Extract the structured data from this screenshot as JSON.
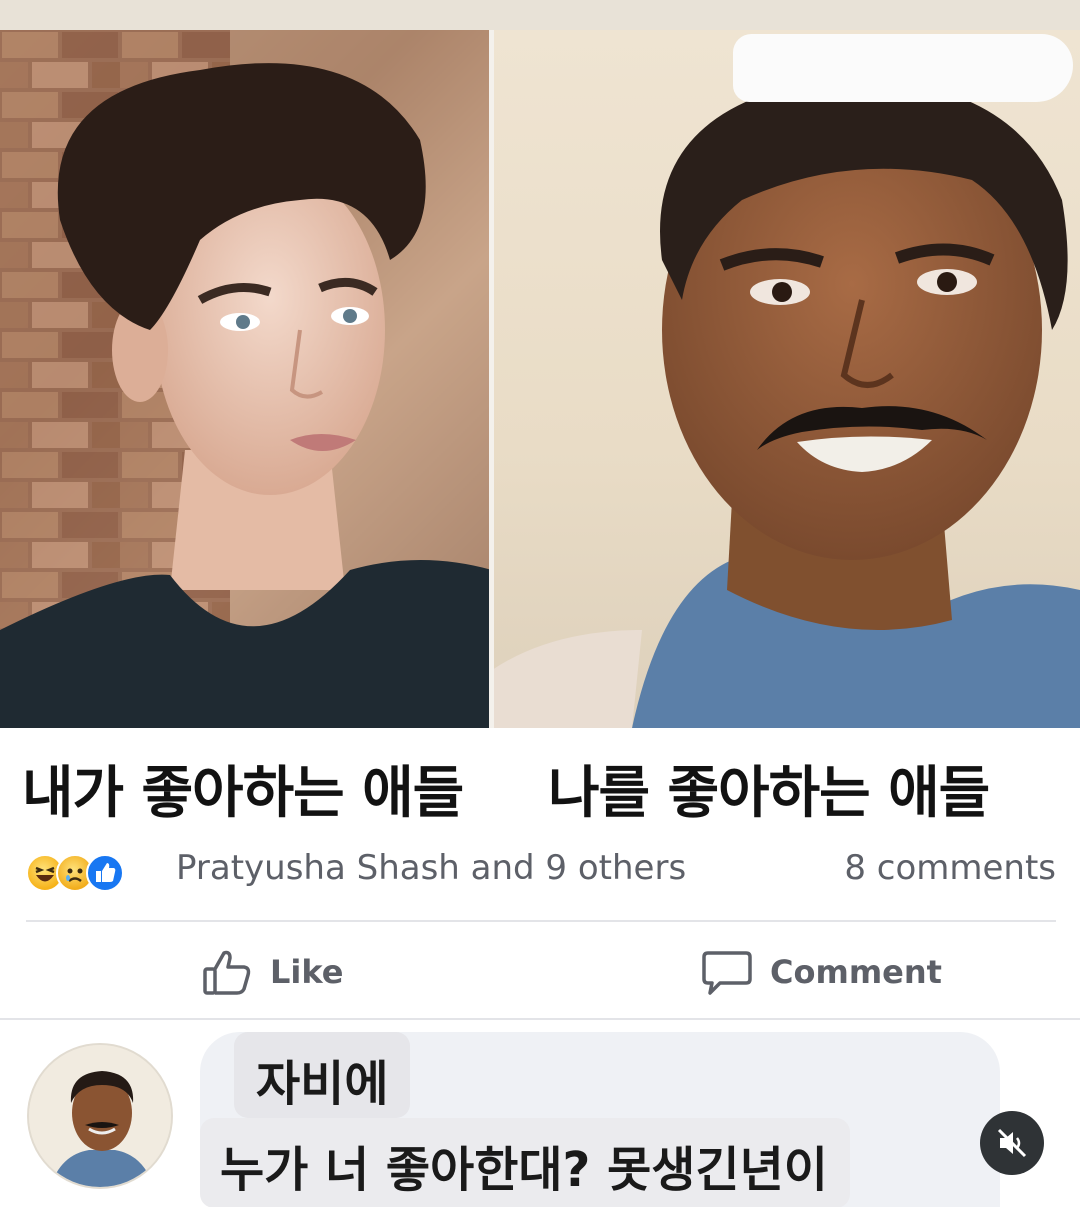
{
  "post": {
    "caption_left": "내가 좋아하는 애들",
    "caption_right": "나를 좋아하는 애들"
  },
  "reactions": {
    "icons": [
      "haha-icon",
      "sad-icon",
      "like-icon"
    ],
    "names": "Pratyusha Shash and 9 others",
    "comment_count": "8 comments"
  },
  "actions": {
    "like_label": "Like",
    "comment_label": "Comment"
  },
  "comment": {
    "author": "자비에",
    "text": "누가 너 좋아한대? 못생긴년이"
  },
  "overlay": {
    "mute_icon": "speaker-muted-icon"
  },
  "colors": {
    "facebook_blue": "#1877f2",
    "meta_text": "#5d6068",
    "comment_bubble": "#eff1f5"
  }
}
